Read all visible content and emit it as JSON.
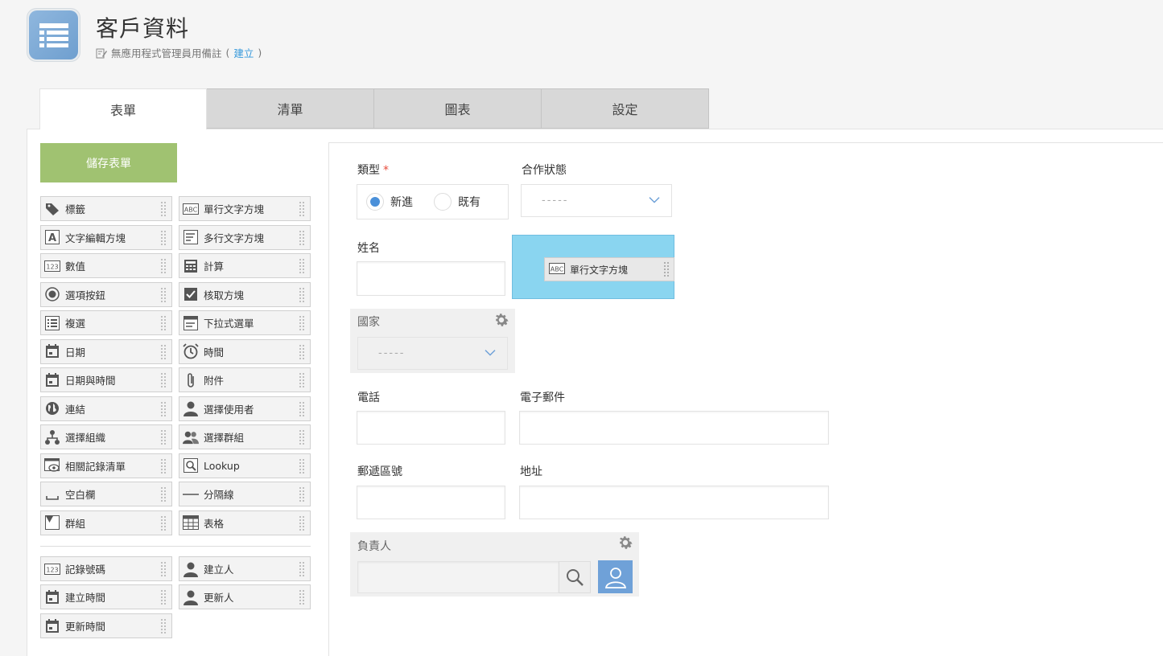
{
  "app": {
    "title": "客戶資料",
    "note_prefix": "無應用程式管理員用備註",
    "note_open": "(",
    "note_link": "建立",
    "note_close": ")"
  },
  "tabs": [
    {
      "label": "表單",
      "active": true
    },
    {
      "label": "清單",
      "active": false
    },
    {
      "label": "圖表",
      "active": false
    },
    {
      "label": "設定",
      "active": false
    }
  ],
  "toolbar": {
    "save_label": "儲存表單"
  },
  "palette": {
    "items": [
      {
        "label": "標籤",
        "icon": "tag-icon"
      },
      {
        "label": "單行文字方塊",
        "icon": "abc-icon"
      },
      {
        "label": "文字編輯方塊",
        "icon": "rich-text-icon"
      },
      {
        "label": "多行文字方塊",
        "icon": "multiline-icon"
      },
      {
        "label": "數值",
        "icon": "number-icon"
      },
      {
        "label": "計算",
        "icon": "calculator-icon"
      },
      {
        "label": "選項按鈕",
        "icon": "radio-icon"
      },
      {
        "label": "核取方塊",
        "icon": "checkbox-icon"
      },
      {
        "label": "複選",
        "icon": "multi-select-icon"
      },
      {
        "label": "下拉式選單",
        "icon": "dropdown-icon"
      },
      {
        "label": "日期",
        "icon": "calendar-icon"
      },
      {
        "label": "時間",
        "icon": "clock-icon"
      },
      {
        "label": "日期與時間",
        "icon": "calendar-icon"
      },
      {
        "label": "附件",
        "icon": "paperclip-icon"
      },
      {
        "label": "連結",
        "icon": "globe-icon"
      },
      {
        "label": "選擇使用者",
        "icon": "user-icon"
      },
      {
        "label": "選擇組織",
        "icon": "org-icon"
      },
      {
        "label": "選擇群組",
        "icon": "group-icon"
      },
      {
        "label": "相關記錄清單",
        "icon": "related-records-icon"
      },
      {
        "label": "Lookup",
        "icon": "lookup-icon"
      },
      {
        "label": "空白欄",
        "icon": "space-icon"
      },
      {
        "label": "分隔線",
        "icon": "line-icon"
      },
      {
        "label": "群組",
        "icon": "group-field-icon"
      },
      {
        "label": "表格",
        "icon": "table-icon"
      }
    ],
    "system_items": [
      {
        "label": "記錄號碼",
        "icon": "number-icon"
      },
      {
        "label": "建立人",
        "icon": "user-icon"
      },
      {
        "label": "建立時間",
        "icon": "calendar-icon"
      },
      {
        "label": "更新人",
        "icon": "user-icon"
      },
      {
        "label": "更新時間",
        "icon": "calendar-icon"
      }
    ]
  },
  "form": {
    "type_label": "類型",
    "required_mark": "*",
    "type_options": [
      "新進",
      "既有"
    ],
    "status_label": "合作狀態",
    "status_value": "-----",
    "name_label": "姓名",
    "drag_label": "單行文字方塊",
    "country_label": "國家",
    "country_value": "-----",
    "phone_label": "電話",
    "email_label": "電子郵件",
    "zip_label": "郵遞區號",
    "address_label": "地址",
    "owner_label": "負責人"
  },
  "colors": {
    "save_button": "#a0c271",
    "drop_zone": "#8ad5f0",
    "accent": "#4a90d9",
    "user_button": "#6fa1d8"
  }
}
